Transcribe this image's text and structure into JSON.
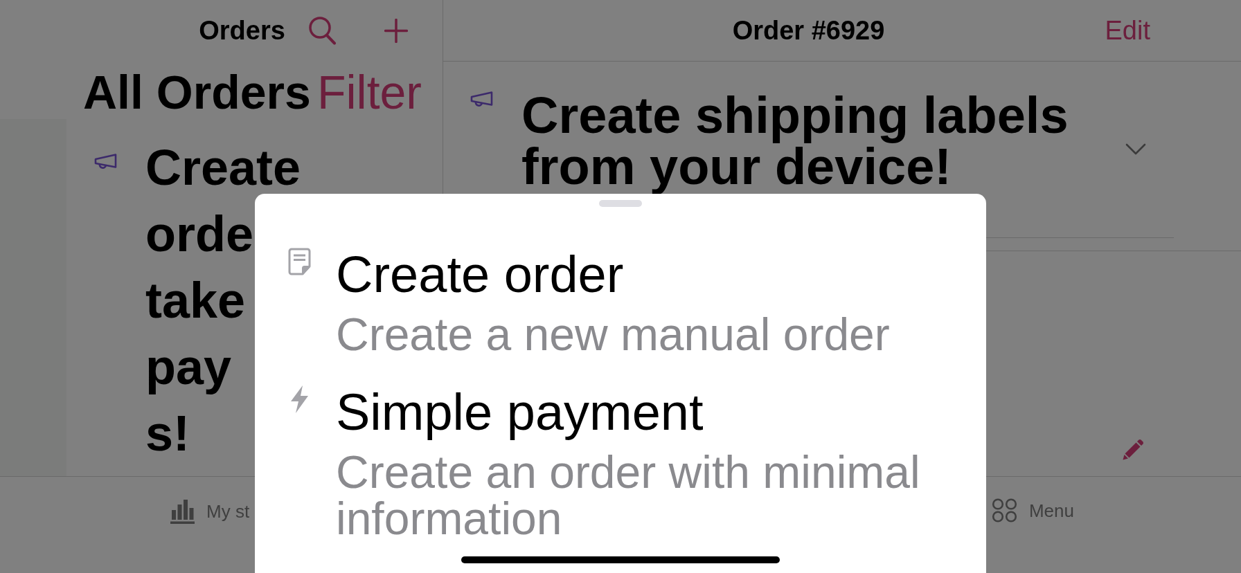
{
  "left_panel": {
    "nav_title": "Orders",
    "large_title": "All Orders",
    "filter_button": "Filter",
    "banner": {
      "lines": [
        "Create",
        "orde",
        "take",
        "pay",
        "s!"
      ]
    }
  },
  "right_panel": {
    "nav_title": "Order #6929",
    "edit_button": "Edit",
    "banner": {
      "text": "Create shipping labels from your device!"
    }
  },
  "tab_bar": {
    "tabs": [
      {
        "label": "My st",
        "selected": false
      },
      {
        "label": "Menu",
        "selected": false
      }
    ]
  },
  "sheet": {
    "options": [
      {
        "title": "Create order",
        "description": "Create a new manual order"
      },
      {
        "title": "Simple payment",
        "description": "Create an order with minimal information"
      }
    ]
  }
}
